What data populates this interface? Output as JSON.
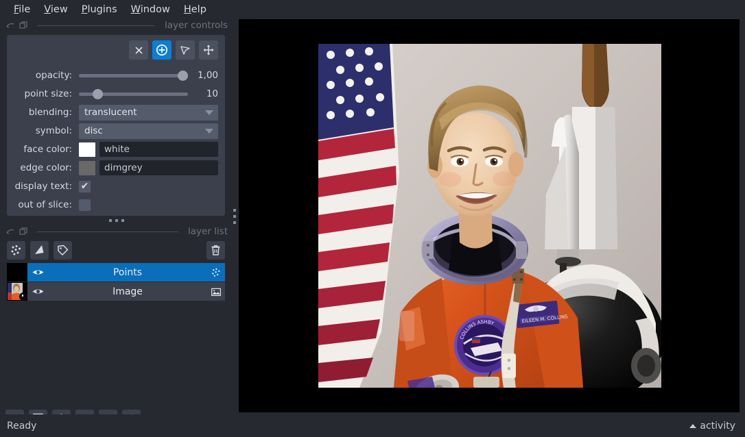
{
  "menubar": {
    "items": [
      {
        "name": "file",
        "pre": "",
        "mn": "F",
        "post": "ile"
      },
      {
        "name": "view",
        "pre": "",
        "mn": "V",
        "post": "iew"
      },
      {
        "name": "plugins",
        "pre": "",
        "mn": "P",
        "post": "lugins"
      },
      {
        "name": "window",
        "pre": "",
        "mn": "W",
        "post": "indow"
      },
      {
        "name": "help",
        "pre": "",
        "mn": "H",
        "post": "elp"
      }
    ]
  },
  "layer_controls": {
    "dock_title": "layer controls",
    "tools": [
      {
        "name": "delete-selected-points-button",
        "icon": "close-icon",
        "active": false
      },
      {
        "name": "add-points-button",
        "icon": "add-circle-icon",
        "active": true
      },
      {
        "name": "select-points-button",
        "icon": "cursor-arrow-icon",
        "active": false
      },
      {
        "name": "pan-zoom-button",
        "icon": "move-arrows-icon",
        "active": false
      }
    ],
    "opacity": {
      "label": "opacity:",
      "value": "1,00",
      "percent": 100
    },
    "point_size": {
      "label": "point size:",
      "value": "10",
      "percent": 14
    },
    "blending": {
      "label": "blending:",
      "value": "translucent"
    },
    "symbol": {
      "label": "symbol:",
      "value": "disc"
    },
    "face_color": {
      "label": "face color:",
      "value": "white",
      "swatch": "#ffffff"
    },
    "edge_color": {
      "label": "edge color:",
      "value": "dimgrey",
      "swatch": "#696969"
    },
    "display_text": {
      "label": "display text:",
      "checked": true,
      "tick": "✔"
    },
    "out_of_slice": {
      "label": "out of slice:",
      "checked": false,
      "tick": ""
    }
  },
  "layer_list": {
    "dock_title": "layer list",
    "buttons": [
      {
        "name": "new-points-layer-button",
        "icon": "points-icon"
      },
      {
        "name": "new-shapes-layer-button",
        "icon": "shapes-icon"
      },
      {
        "name": "new-labels-layer-button",
        "icon": "labels-tag-icon"
      }
    ],
    "delete_button": {
      "name": "delete-layer-button",
      "icon": "trash-icon"
    },
    "layers": [
      {
        "name": "Points",
        "type": "points",
        "selected": true,
        "visible": true
      },
      {
        "name": "Image",
        "type": "image",
        "selected": false,
        "visible": true
      }
    ]
  },
  "viewer_buttons": [
    {
      "name": "console-button",
      "icon": "terminal-icon"
    },
    {
      "name": "ndisplay-toggle-button",
      "icon": "square-2d-icon"
    },
    {
      "name": "ndisplay-3d-button",
      "icon": "cube-3d-icon"
    },
    {
      "name": "roll-dims-button",
      "icon": "roll-dimensions-icon"
    },
    {
      "name": "grid-view-button",
      "icon": "grid-icon"
    },
    {
      "name": "reset-view-button",
      "icon": "home-icon"
    }
  ],
  "statusbar": {
    "status": "Ready",
    "activity_label": "activity"
  },
  "colors": {
    "background": "#262930",
    "panel": "#3b404c",
    "accent": "#0a7fd4",
    "selected_row": "#0a6fbb",
    "text": "#d6d8de",
    "dock_label": "#6e7380",
    "canvas": "#000000"
  }
}
